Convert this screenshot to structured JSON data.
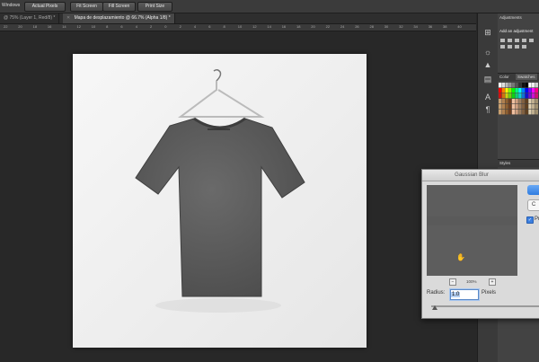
{
  "toolbar": {
    "menu_label": "Windows",
    "buttons": [
      "Actual Pixels",
      "Fit Screen",
      "Fill Screen",
      "Print Size"
    ]
  },
  "tabs": [
    {
      "label": "@ 75% (Layer 1, Red/8) *",
      "active": false
    },
    {
      "label": "Mapa de desplazamiento @ 66.7% (Alpha 1/8) *",
      "active": true
    }
  ],
  "ruler_ticks": [
    "22",
    "20",
    "18",
    "16",
    "14",
    "12",
    "10",
    "8",
    "6",
    "4",
    "2",
    "0",
    "2",
    "4",
    "6",
    "8",
    "10",
    "12",
    "14",
    "16",
    "18",
    "20",
    "22",
    "24",
    "26",
    "28",
    "30",
    "32",
    "34",
    "36",
    "38",
    "40"
  ],
  "right_panel": {
    "adjustments_tab": "Adjustments",
    "adjustments_hint": "Add an adjustment",
    "color_tab": "Color",
    "swatches_tab": "Swatches",
    "styles_tab": "Styles"
  },
  "gaussian_blur": {
    "title": "Gaussian Blur",
    "ok_label": "",
    "cancel_label": "C",
    "preview_label": "Pr",
    "zoom": "100%",
    "zoom_out": "−",
    "zoom_in": "+",
    "radius_label": "Radius:",
    "radius_value": "1.0",
    "radius_unit": "Pixels",
    "preview_checked": true
  },
  "colors": {
    "ui_dark": "#282828",
    "panel": "#434343",
    "accent_blue": "#2f7ce0",
    "tshirt": "#565656"
  }
}
